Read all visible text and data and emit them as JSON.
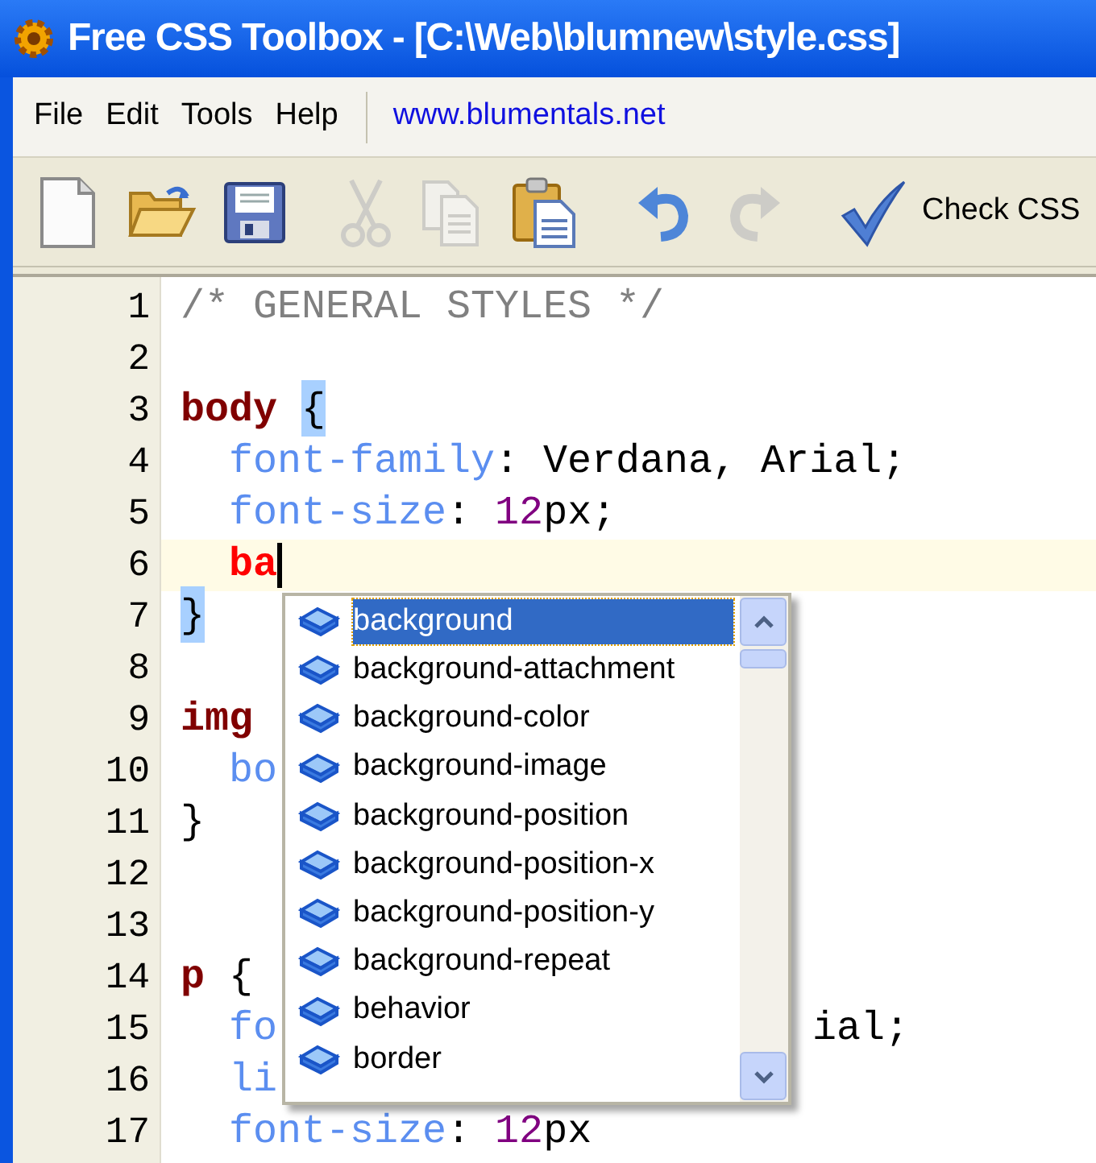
{
  "window": {
    "title": "Free CSS Toolbox - [C:\\Web\\blumnew\\style.css]"
  },
  "menu": [
    "File",
    "Edit",
    "Tools",
    "Help"
  ],
  "link": "www.blumentals.net",
  "toolbar": [
    {
      "kind": "new",
      "disabled": false
    },
    {
      "kind": "open",
      "disabled": false
    },
    {
      "kind": "save",
      "disabled": false
    },
    {
      "kind": "separator"
    },
    {
      "kind": "cut",
      "disabled": true
    },
    {
      "kind": "copy",
      "disabled": true
    },
    {
      "kind": "paste",
      "disabled": false
    },
    {
      "kind": "separator"
    },
    {
      "kind": "undo",
      "disabled": false
    },
    {
      "kind": "redo",
      "disabled": true
    },
    {
      "kind": "separator"
    },
    {
      "kind": "check",
      "disabled": false,
      "label": "Check CSS"
    }
  ],
  "editor": {
    "lines": [
      {
        "number": "1",
        "current": false,
        "indented": false,
        "tokens": [
          {
            "kind": "comment",
            "text": "/* GENERAL STYLES */"
          }
        ]
      },
      {
        "number": "2",
        "current": false
      },
      {
        "number": "3",
        "current": false,
        "indented": false,
        "tokens": [
          {
            "kind": "selector",
            "text": "body"
          },
          {
            "kind": "brace",
            "text": "{",
            "matched": true
          }
        ]
      },
      {
        "number": "4",
        "current": false,
        "indented": true,
        "tokens": [
          {
            "kind": "property",
            "text": "font-family"
          },
          {
            "kind": "plain",
            "text": ": Verdana, Arial;"
          }
        ]
      },
      {
        "number": "5",
        "current": false,
        "indented": true,
        "tokens": [
          {
            "kind": "property",
            "text": "font-size"
          },
          {
            "kind": "plain",
            "text": ": "
          },
          {
            "kind": "number",
            "text": "12"
          },
          {
            "kind": "plain",
            "text": "px;"
          }
        ]
      },
      {
        "number": "6",
        "current": true,
        "indented": true,
        "tokens": [
          {
            "kind": "typed",
            "text": "ba"
          }
        ]
      },
      {
        "number": "7",
        "current": false,
        "indented": false,
        "tokens": [
          {
            "kind": "brace",
            "text": "}",
            "matched": true
          }
        ]
      },
      {
        "number": "8",
        "current": false
      },
      {
        "number": "9",
        "current": false,
        "indented": false,
        "tokens": [
          {
            "kind": "selector",
            "text": "img"
          }
        ]
      },
      {
        "number": "10",
        "current": false,
        "indented": true,
        "tokens": [
          {
            "kind": "property",
            "text": "bo"
          }
        ]
      },
      {
        "number": "11",
        "current": false,
        "indented": false,
        "tokens": [
          {
            "kind": "brace",
            "text": "}",
            "matched": false
          }
        ]
      },
      {
        "number": "12",
        "current": false
      },
      {
        "number": "13",
        "current": false
      },
      {
        "number": "14",
        "current": false,
        "indented": false,
        "tokens": [
          {
            "kind": "selector",
            "text": "p"
          },
          {
            "kind": "brace",
            "text": "{",
            "matched": false
          }
        ]
      },
      {
        "number": "15",
        "current": false,
        "indented": true,
        "tokens": [
          {
            "kind": "property",
            "text": "fo"
          },
          {
            "kind": "after_popup",
            "text": "ial;"
          }
        ]
      },
      {
        "number": "16",
        "current": false,
        "indented": true,
        "tokens": [
          {
            "kind": "property",
            "text": "li"
          }
        ]
      },
      {
        "number": "17",
        "current": false,
        "indented": true,
        "tokens": [
          {
            "kind": "property",
            "text": "font-size"
          },
          {
            "kind": "plain",
            "text": ": "
          },
          {
            "kind": "number",
            "text": "12"
          },
          {
            "kind": "plain",
            "text": "px"
          }
        ]
      }
    ]
  },
  "completion": {
    "items": [
      {
        "label": "background",
        "selected": true
      },
      {
        "label": "background-attachment",
        "selected": false
      },
      {
        "label": "background-color",
        "selected": false
      },
      {
        "label": "background-image",
        "selected": false
      },
      {
        "label": "background-position",
        "selected": false
      },
      {
        "label": "background-position-x",
        "selected": false
      },
      {
        "label": "background-position-y",
        "selected": false
      },
      {
        "label": "background-repeat",
        "selected": false
      },
      {
        "label": "behavior",
        "selected": false
      },
      {
        "label": "border",
        "selected": false
      }
    ]
  }
}
